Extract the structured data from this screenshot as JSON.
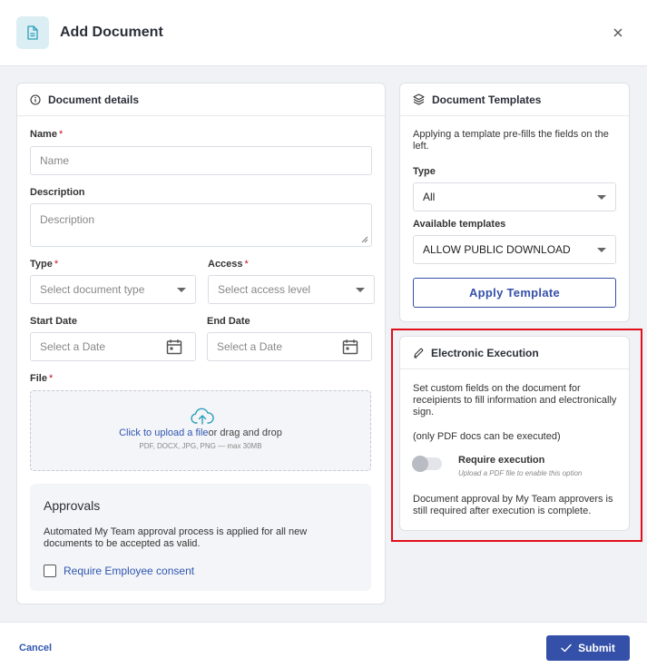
{
  "modal": {
    "title": "Add Document",
    "title_icon": "document-icon",
    "close_icon": "close-icon"
  },
  "details": {
    "heading": "Document details",
    "heading_icon": "info-icon",
    "name_label": "Name",
    "name_placeholder": "Name",
    "description_label": "Description",
    "description_placeholder": "Description",
    "type_label": "Type",
    "type_placeholder": "Select document type",
    "access_label": "Access",
    "access_placeholder": "Select access level",
    "start_date_label": "Start Date",
    "start_date_placeholder": "Select a Date",
    "end_date_label": "End Date",
    "end_date_placeholder": "Select a Date",
    "file_label": "File",
    "required_mark": "*",
    "upload_link": "Click to upload a file",
    "upload_rest": "or drag and drop",
    "upload_formats": "PDF, DOCX, JPG, PNG — max 30MB"
  },
  "approvals": {
    "title": "Approvals",
    "description": "Automated My Team approval process is applied for all new documents to be accepted as valid.",
    "consent_label": "Require Employee consent",
    "consent_checked": false
  },
  "templates": {
    "heading": "Document Templates",
    "heading_icon": "layers-icon",
    "intro": "Applying a template pre-fills the fields on the left.",
    "type_label": "Type",
    "type_value": "All",
    "available_label": "Available templates",
    "available_value": "ALLOW PUBLIC DOWNLOAD",
    "apply_button": "Apply Template"
  },
  "execution": {
    "heading": "Electronic Execution",
    "heading_icon": "pencil-icon",
    "intro": "Set custom fields on the document for receipients to fill information and electronically sign.",
    "pdf_only": "(only PDF docs can be executed)",
    "toggle_label": "Require execution",
    "toggle_hint": "Upload a PDF file to enable this option",
    "toggle_on": false,
    "note": "Document approval by My Team approvers is still required after execution is complete."
  },
  "footer": {
    "cancel": "Cancel",
    "submit": "Submit"
  },
  "colors": {
    "accent": "#3450a8",
    "link": "#2f56b0",
    "required": "#c8102e",
    "highlight": "#e0101a"
  }
}
